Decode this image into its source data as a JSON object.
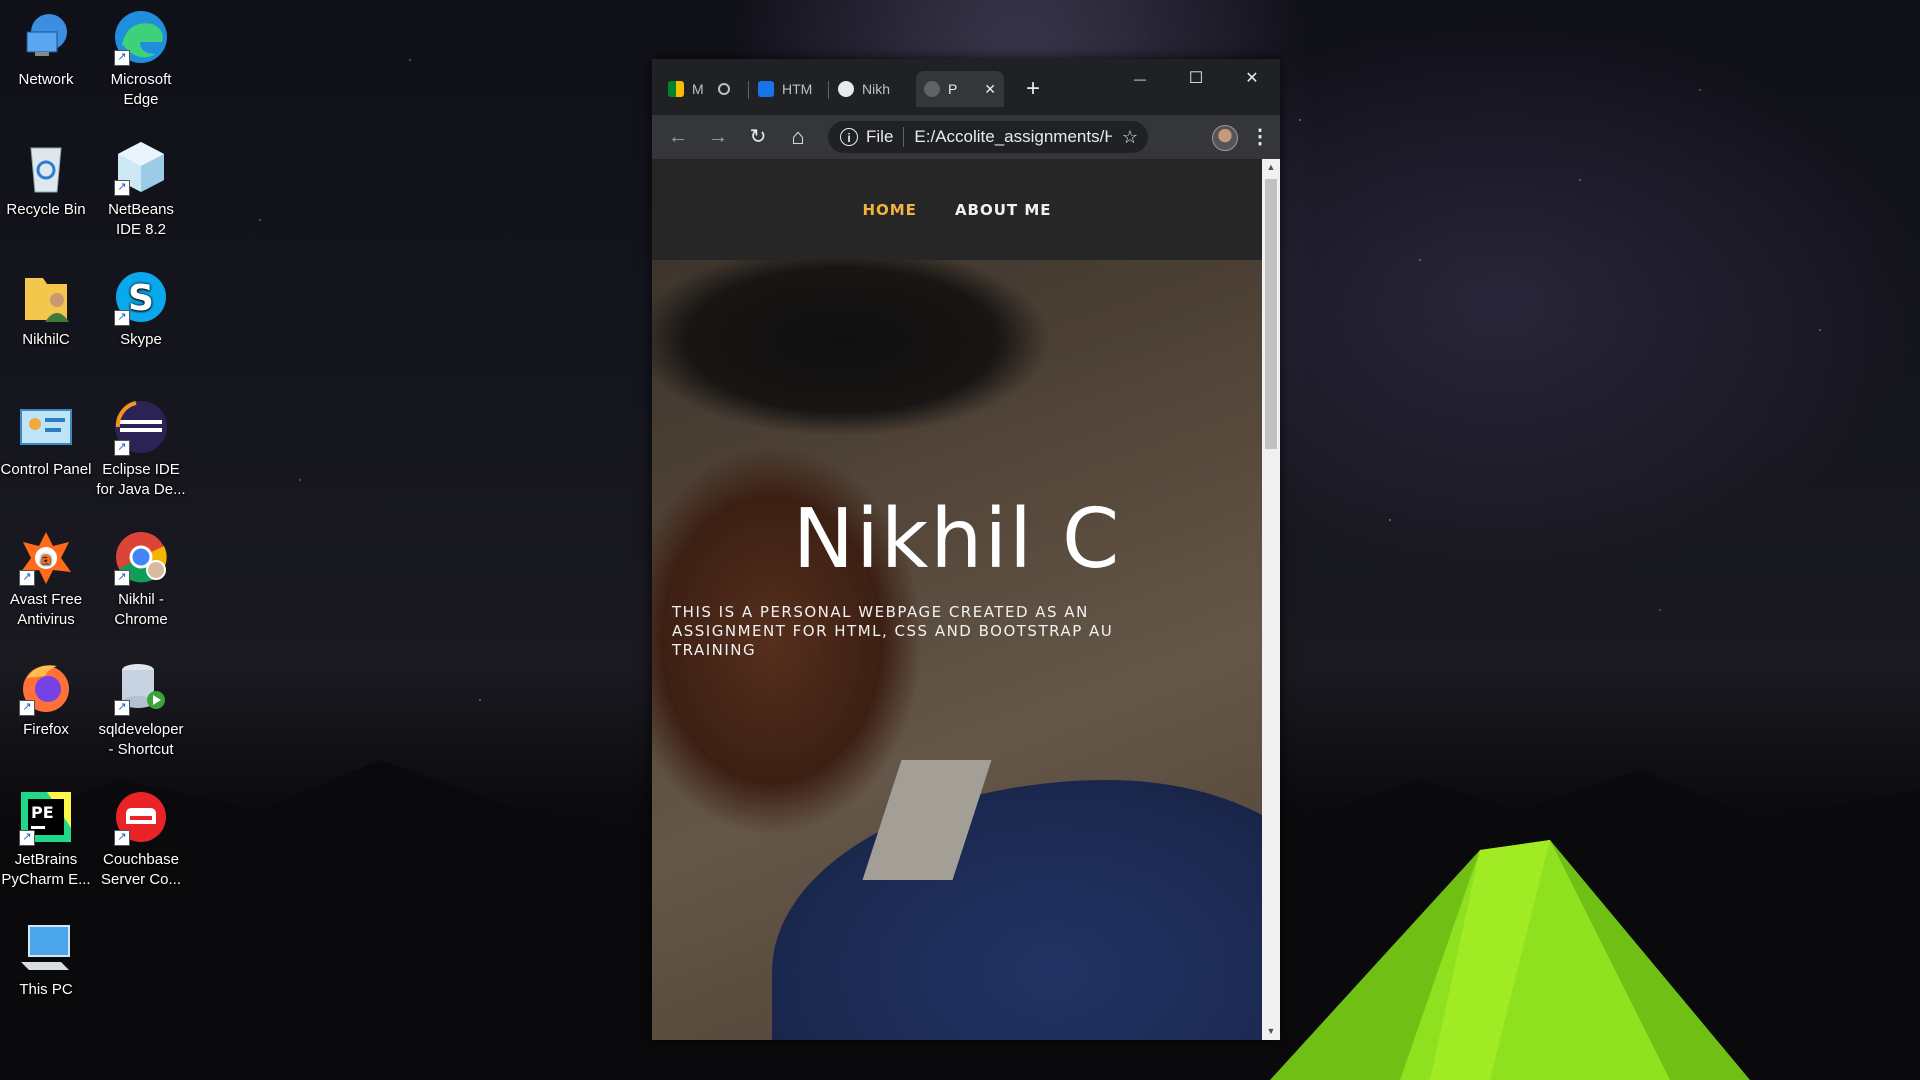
{
  "desktop": {
    "icons": [
      {
        "label": "Network",
        "icon": "network-icon"
      },
      {
        "label": "Microsoft Edge",
        "icon": "edge-icon"
      },
      {
        "label": "Recycle Bin",
        "icon": "recycle-bin-icon"
      },
      {
        "label": "NetBeans IDE 8.2",
        "icon": "netbeans-icon"
      },
      {
        "label": "NikhilC",
        "icon": "user-folder-icon"
      },
      {
        "label": "Skype",
        "icon": "skype-icon"
      },
      {
        "label": "Control Panel",
        "icon": "control-panel-icon"
      },
      {
        "label": "Eclipse IDE for Java De...",
        "icon": "eclipse-icon"
      },
      {
        "label": "Avast Free Antivirus",
        "icon": "avast-icon"
      },
      {
        "label": "Nikhil - Chrome",
        "icon": "chrome-profile-icon"
      },
      {
        "label": "Firefox",
        "icon": "firefox-icon"
      },
      {
        "label": "sqldeveloper - Shortcut",
        "icon": "sqldeveloper-icon"
      },
      {
        "label": "JetBrains PyCharm E...",
        "icon": "pycharm-icon"
      },
      {
        "label": "Couchbase Server Co...",
        "icon": "couchbase-icon"
      },
      {
        "label": "This PC",
        "icon": "this-pc-icon"
      }
    ]
  },
  "browser": {
    "tabs": [
      {
        "label": "M",
        "icon": "meet-icon"
      },
      {
        "label": "HTM",
        "icon": "classroom-icon"
      },
      {
        "label": "Nikh",
        "icon": "github-icon"
      },
      {
        "label": "P",
        "icon": "globe-icon"
      }
    ],
    "new_tab_symbol": "+",
    "window_controls": {
      "minimize": "—",
      "maximize": "☐",
      "close": "✕"
    },
    "toolbar": {
      "back": "←",
      "forward": "→",
      "reload": "↻",
      "home": "⌂",
      "star": "☆",
      "menu": "⋮"
    },
    "address": {
      "scheme": "File",
      "url": "E:/Accolite_assignments/H..."
    }
  },
  "site": {
    "nav": {
      "home": "HOME",
      "about": "ABOUT ME"
    },
    "hero": {
      "name": "Nikhil C",
      "tagline": "THIS IS A PERSONAL WEBPAGE CREATED AS AN ASSIGNMENT FOR HTML, CSS AND BOOTSTRAP AU TRAINING"
    },
    "accent_color": "#f0b541"
  }
}
